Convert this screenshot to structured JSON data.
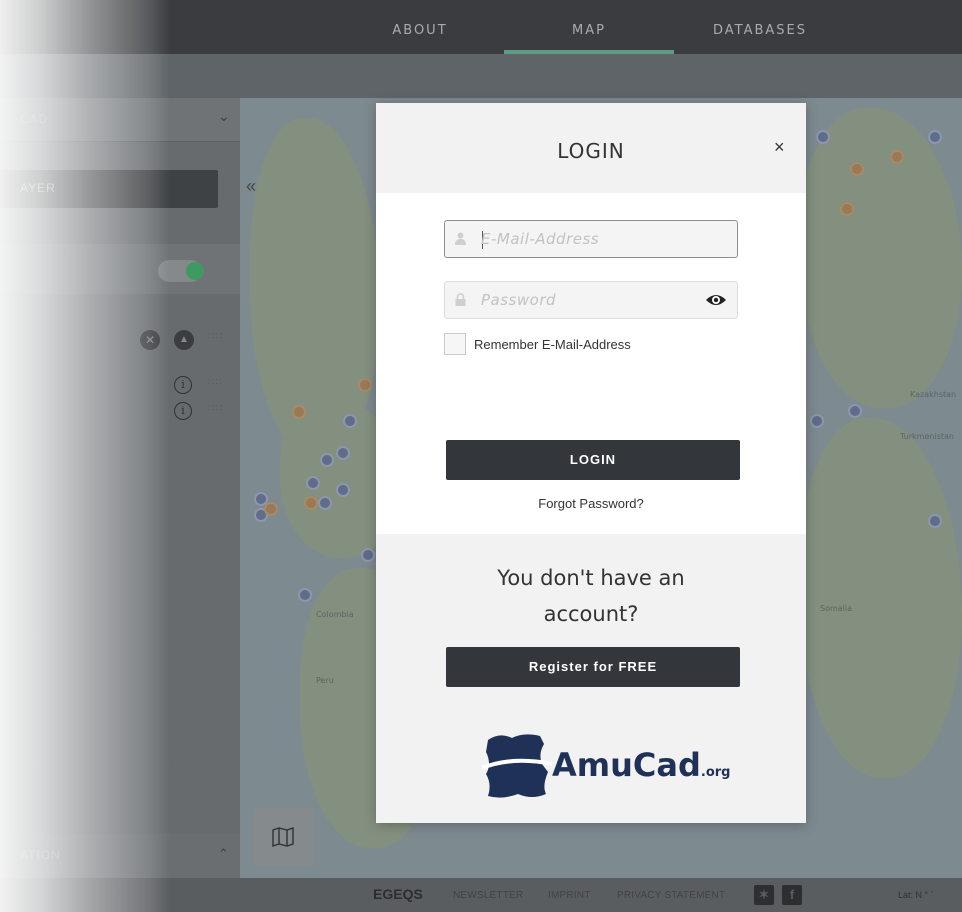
{
  "nav": {
    "items": [
      {
        "label": "ABOUT"
      },
      {
        "label": "MAP",
        "active": true
      },
      {
        "label": "DATABASES"
      }
    ]
  },
  "left_panel": {
    "select_label": "CAD",
    "layer_button_label": "AYER",
    "bottom_label": "ATION",
    "toggle_on": true
  },
  "footer": {
    "brand": "EGEQS",
    "links": [
      "NEWSLETTER",
      "IMPRINT",
      "PRIVACY STATEMENT"
    ],
    "social": [
      "twitter-icon",
      "facebook-icon"
    ],
    "latlon": "Lat: N ° ´"
  },
  "modal": {
    "title": "LOGIN",
    "close_label": "×",
    "email_placeholder": "E-Mail-Address",
    "password_placeholder": "Password",
    "remember_label": "Remember E-Mail-Address",
    "login_button": "LOGIN",
    "forgot_link": "Forgot Password?",
    "no_account_text": "You don't have an account?",
    "register_button": "Register for FREE",
    "brand_name": "AmuCad",
    "brand_tld": ".org"
  },
  "colors": {
    "dark_button": "#33363a",
    "nav_active_underline": "#5f9a82",
    "brand_blue": "#1f3156",
    "toggle_on": "#3f9a62"
  },
  "map_labels": [
    "Colombia",
    "Peru",
    "Kazakhstan",
    "Turkmenistan",
    "Somalia"
  ]
}
